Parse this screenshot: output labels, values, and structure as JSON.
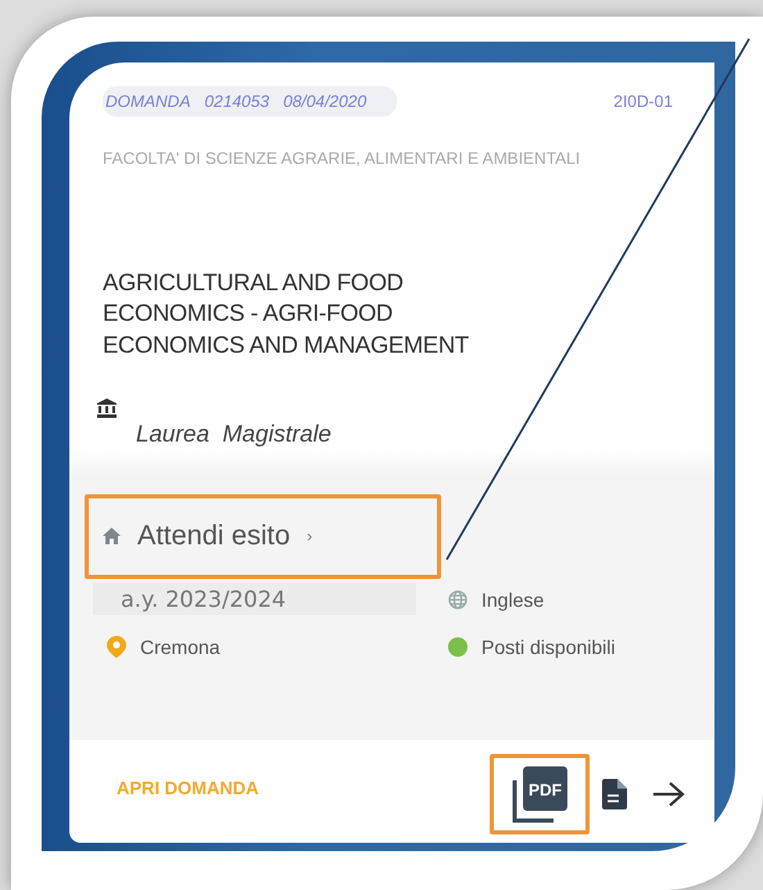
{
  "application": {
    "label": "DOMANDA",
    "number": "0214053",
    "date": "08/04/2020",
    "code": "2I0D-01"
  },
  "faculty": "FACOLTA' DI SCIENZE AGRARIE, ALIMENTARI E AMBIENTALI",
  "course_title": "AGRICULTURAL AND FOOD ECONOMICS - AGRI-FOOD ECONOMICS AND MANAGEMENT",
  "degree_type": "Laurea  Magistrale",
  "status": {
    "label": "Attendi esito",
    "chevron": "›",
    "highlighted": true
  },
  "details": [
    {
      "kind": "year",
      "text": "a.y. 2023/2024"
    },
    {
      "kind": "language",
      "text": "Inglese"
    },
    {
      "kind": "location",
      "text": "Cremona",
      "color": "#f2a81d"
    },
    {
      "kind": "availability",
      "text": "Posti disponibili",
      "color": "#7cc04a"
    }
  ],
  "footer": {
    "open_label": "APRI DOMANDA",
    "actions": [
      {
        "kind": "pdf",
        "text": "PDF",
        "highlighted": true
      },
      {
        "kind": "document",
        "highlighted": false
      },
      {
        "kind": "arrow",
        "highlighted": false
      }
    ]
  }
}
